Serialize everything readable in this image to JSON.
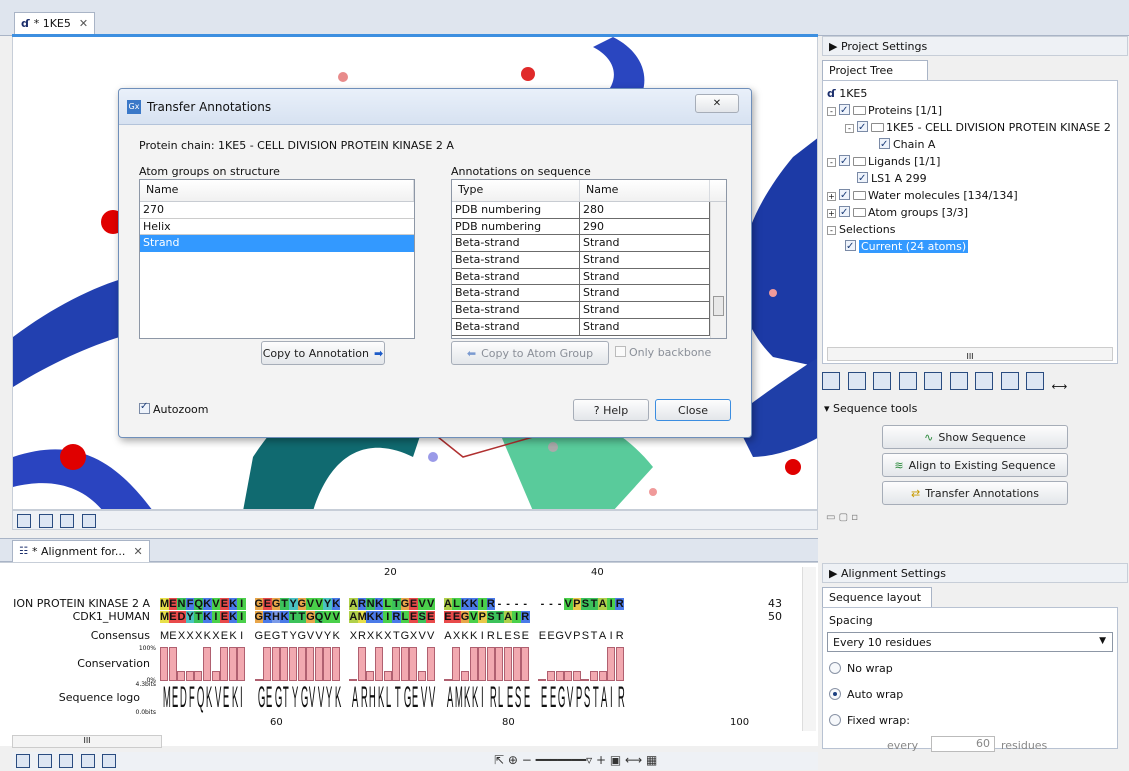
{
  "structure_tab": {
    "label": "* 1KE5",
    "close": "✕"
  },
  "alignment_tab": {
    "label": "* Alignment for...",
    "close": "✕"
  },
  "dialog": {
    "title": "Transfer Annotations",
    "close": "✕",
    "protein_chain": "Protein chain: 1KE5 - CELL DIVISION PROTEIN KINASE 2 A",
    "atom_groups_heading": "Atom groups on structure",
    "atom_groups_col": "Name",
    "atom_groups": [
      "270",
      "Helix",
      "Strand"
    ],
    "annotations_heading": "Annotations on sequence",
    "annotations_cols": [
      "Type",
      "Name"
    ],
    "annotations": [
      {
        "type": "PDB numbering",
        "name": "280"
      },
      {
        "type": "PDB numbering",
        "name": "290"
      },
      {
        "type": "Beta-strand",
        "name": "Strand"
      },
      {
        "type": "Beta-strand",
        "name": "Strand"
      },
      {
        "type": "Beta-strand",
        "name": "Strand"
      },
      {
        "type": "Beta-strand",
        "name": "Strand"
      },
      {
        "type": "Beta-strand",
        "name": "Strand"
      },
      {
        "type": "Beta-strand",
        "name": "Strand"
      }
    ],
    "copy_to_annotation": "Copy to Annotation",
    "copy_to_atom_group": "Copy to Atom Group",
    "only_backbone": "Only backbone",
    "autozoom": "Autozoom",
    "help": "? Help",
    "close_btn": "Close"
  },
  "project_settings": {
    "header": "Project Settings",
    "tab": "Project Tree",
    "tree": {
      "root": "1KE5",
      "proteins": "Proteins [1/1]",
      "protein_item": "1KE5 - CELL DIVISION PROTEIN KINASE 2",
      "chain": "Chain A",
      "ligands": "Ligands [1/1]",
      "ligand_item": "LS1 A 299",
      "water": "Water molecules [134/134]",
      "atom_groups": "Atom groups [3/3]",
      "selections": "Selections",
      "current": "Current (24 atoms)"
    },
    "hscroll": "III",
    "sequence_tools": "Sequence tools",
    "show_sequence": "Show Sequence",
    "align_existing": "Align to Existing Sequence",
    "transfer_annotations": "Transfer Annotations"
  },
  "alignment_settings": {
    "header": "Alignment Settings",
    "tab": "Sequence layout",
    "spacing_label": "Spacing",
    "spacing_value": "Every 10 residues",
    "no_wrap": "No wrap",
    "auto_wrap": "Auto wrap",
    "fixed_wrap": "Fixed wrap:",
    "every": "every",
    "every_value": "60",
    "residues": "residues"
  },
  "alignment": {
    "ruler_top": [
      "20",
      "40"
    ],
    "ruler_bottom": [
      "60",
      "80",
      "100"
    ],
    "rows": [
      {
        "label": "ION PROTEIN KINASE 2 A",
        "seq": "MENFQKVEKI GEGTYGVVYK ARNKLTGEVV ALKKIR---- ---VPSTAIR",
        "end": "43"
      },
      {
        "label": "CDK1_HUMAN",
        "seq": "MEDYTKIEKI GRHKTTGQVV AMKKIRLESE EEGVPSTAIR",
        "end": "50"
      }
    ],
    "consensus_label": "Consensus",
    "consensus": "MEXXXKXEKI GEGTYGVVYK XRXKXTGXVV AXKKIRLESE EEGVPSTAIR",
    "conservation_label": "Conservation",
    "conservation_top": "100%",
    "conservation_bottom": "0%",
    "conservation": [
      1,
      1,
      0.3,
      0.3,
      0.3,
      1,
      0.3,
      1,
      1,
      1,
      0,
      1,
      1,
      1,
      1,
      1,
      1,
      1,
      1,
      1,
      0,
      1,
      0.3,
      1,
      0.3,
      1,
      1,
      1,
      0.3,
      1,
      0,
      1,
      0.3,
      1,
      1,
      1,
      1,
      1,
      1,
      1,
      0,
      0.3,
      0.3,
      0.3,
      0.3,
      0,
      0.3,
      0.3,
      1,
      1,
      1,
      1,
      1,
      1,
      1
    ],
    "logo_label": "Sequence logo",
    "logo_top": "4.3bits",
    "logo_bottom": "0.0bits",
    "logo": "MEDFQKVEKI GEGTYGVVYK ARHKLTGEVV AMKKIRLESE EEGVPSTAIR",
    "hscroll": "III"
  },
  "colors": {
    "accent": "#3399ff",
    "helix": "#1f3fa8",
    "teal": "#12707a"
  }
}
